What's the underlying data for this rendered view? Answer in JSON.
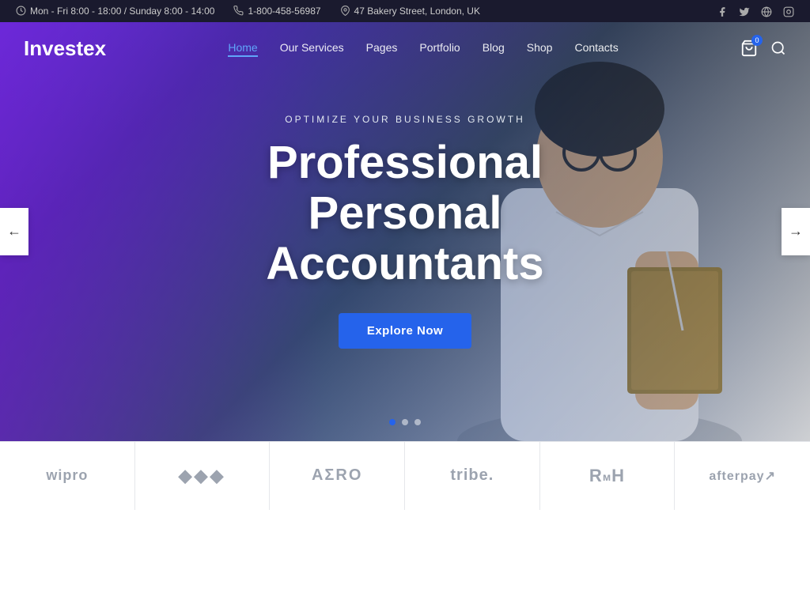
{
  "topbar": {
    "hours": "Mon - Fri 8:00 - 18:00 / Sunday 8:00 - 14:00",
    "phone": "1-800-458-56987",
    "address": "47 Bakery Street, London, UK"
  },
  "navbar": {
    "logo": "Investex",
    "links": [
      {
        "label": "Home",
        "active": true
      },
      {
        "label": "Our Services",
        "active": false
      },
      {
        "label": "Pages",
        "active": false
      },
      {
        "label": "Portfolio",
        "active": false
      },
      {
        "label": "Blog",
        "active": false
      },
      {
        "label": "Shop",
        "active": false
      },
      {
        "label": "Contacts",
        "active": false
      }
    ],
    "cart_count": "0"
  },
  "hero": {
    "subtitle": "OPTIMIZE YOUR BUSINESS GROWTH",
    "title": "Professional Personal Accountants",
    "cta_label": "Explore Now"
  },
  "logos": [
    {
      "name": "wipro",
      "display": "wipro"
    },
    {
      "name": "diamonds",
      "display": "◆◆◆"
    },
    {
      "name": "aero",
      "display": "AΣRO"
    },
    {
      "name": "tribe",
      "display": "tribe."
    },
    {
      "name": "rmh",
      "display": "RᴠH"
    },
    {
      "name": "afterpay",
      "display": "afterpay↗"
    }
  ]
}
